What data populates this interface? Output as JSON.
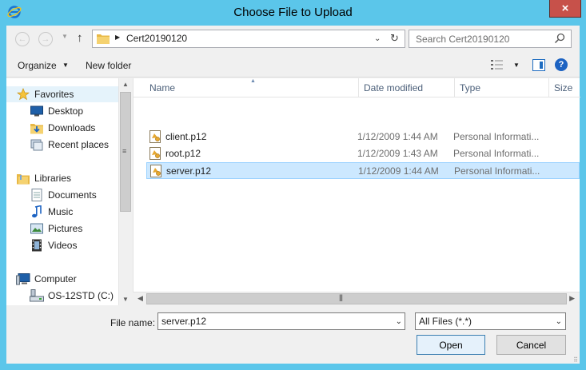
{
  "window": {
    "title": "Choose File to Upload",
    "close_label": "×"
  },
  "address": {
    "path": "Cert20190120",
    "search_placeholder": "Search Cert20190120"
  },
  "toolbar": {
    "organize_label": "Organize",
    "new_folder_label": "New folder"
  },
  "nav_pane": {
    "groups": [
      {
        "label": "Favorites",
        "icon": "star-icon"
      },
      {
        "label": "Desktop",
        "icon": "desktop-icon"
      },
      {
        "label": "Downloads",
        "icon": "downloads-icon"
      },
      {
        "label": "Recent places",
        "icon": "recent-places-icon"
      },
      {
        "label": "Libraries",
        "icon": "libraries-icon"
      },
      {
        "label": "Documents",
        "icon": "documents-icon"
      },
      {
        "label": "Music",
        "icon": "music-icon"
      },
      {
        "label": "Pictures",
        "icon": "pictures-icon"
      },
      {
        "label": "Videos",
        "icon": "videos-icon"
      },
      {
        "label": "Computer",
        "icon": "computer-icon"
      },
      {
        "label": "OS-12STD (C:)",
        "icon": "drive-icon"
      }
    ]
  },
  "columns": {
    "name": "Name",
    "date_modified": "Date modified",
    "type": "Type",
    "size": "Size"
  },
  "files": [
    {
      "name": "client.p12",
      "date": "1/12/2009 1:44 AM",
      "type": "Personal Informati...",
      "selected": false
    },
    {
      "name": "root.p12",
      "date": "1/12/2009 1:43 AM",
      "type": "Personal Informati...",
      "selected": false
    },
    {
      "name": "server.p12",
      "date": "1/12/2009 1:44 AM",
      "type": "Personal Informati...",
      "selected": true
    }
  ],
  "footer": {
    "file_name_label": "File name:",
    "file_name_value": "server.p12",
    "filter_value": "All Files (*.*)",
    "open_label": "Open",
    "cancel_label": "Cancel"
  },
  "colors": {
    "title_bar": "#5bc6ea",
    "close_button": "#c7514a",
    "selection": "#cce8ff",
    "column_header_text": "#4c607a"
  }
}
